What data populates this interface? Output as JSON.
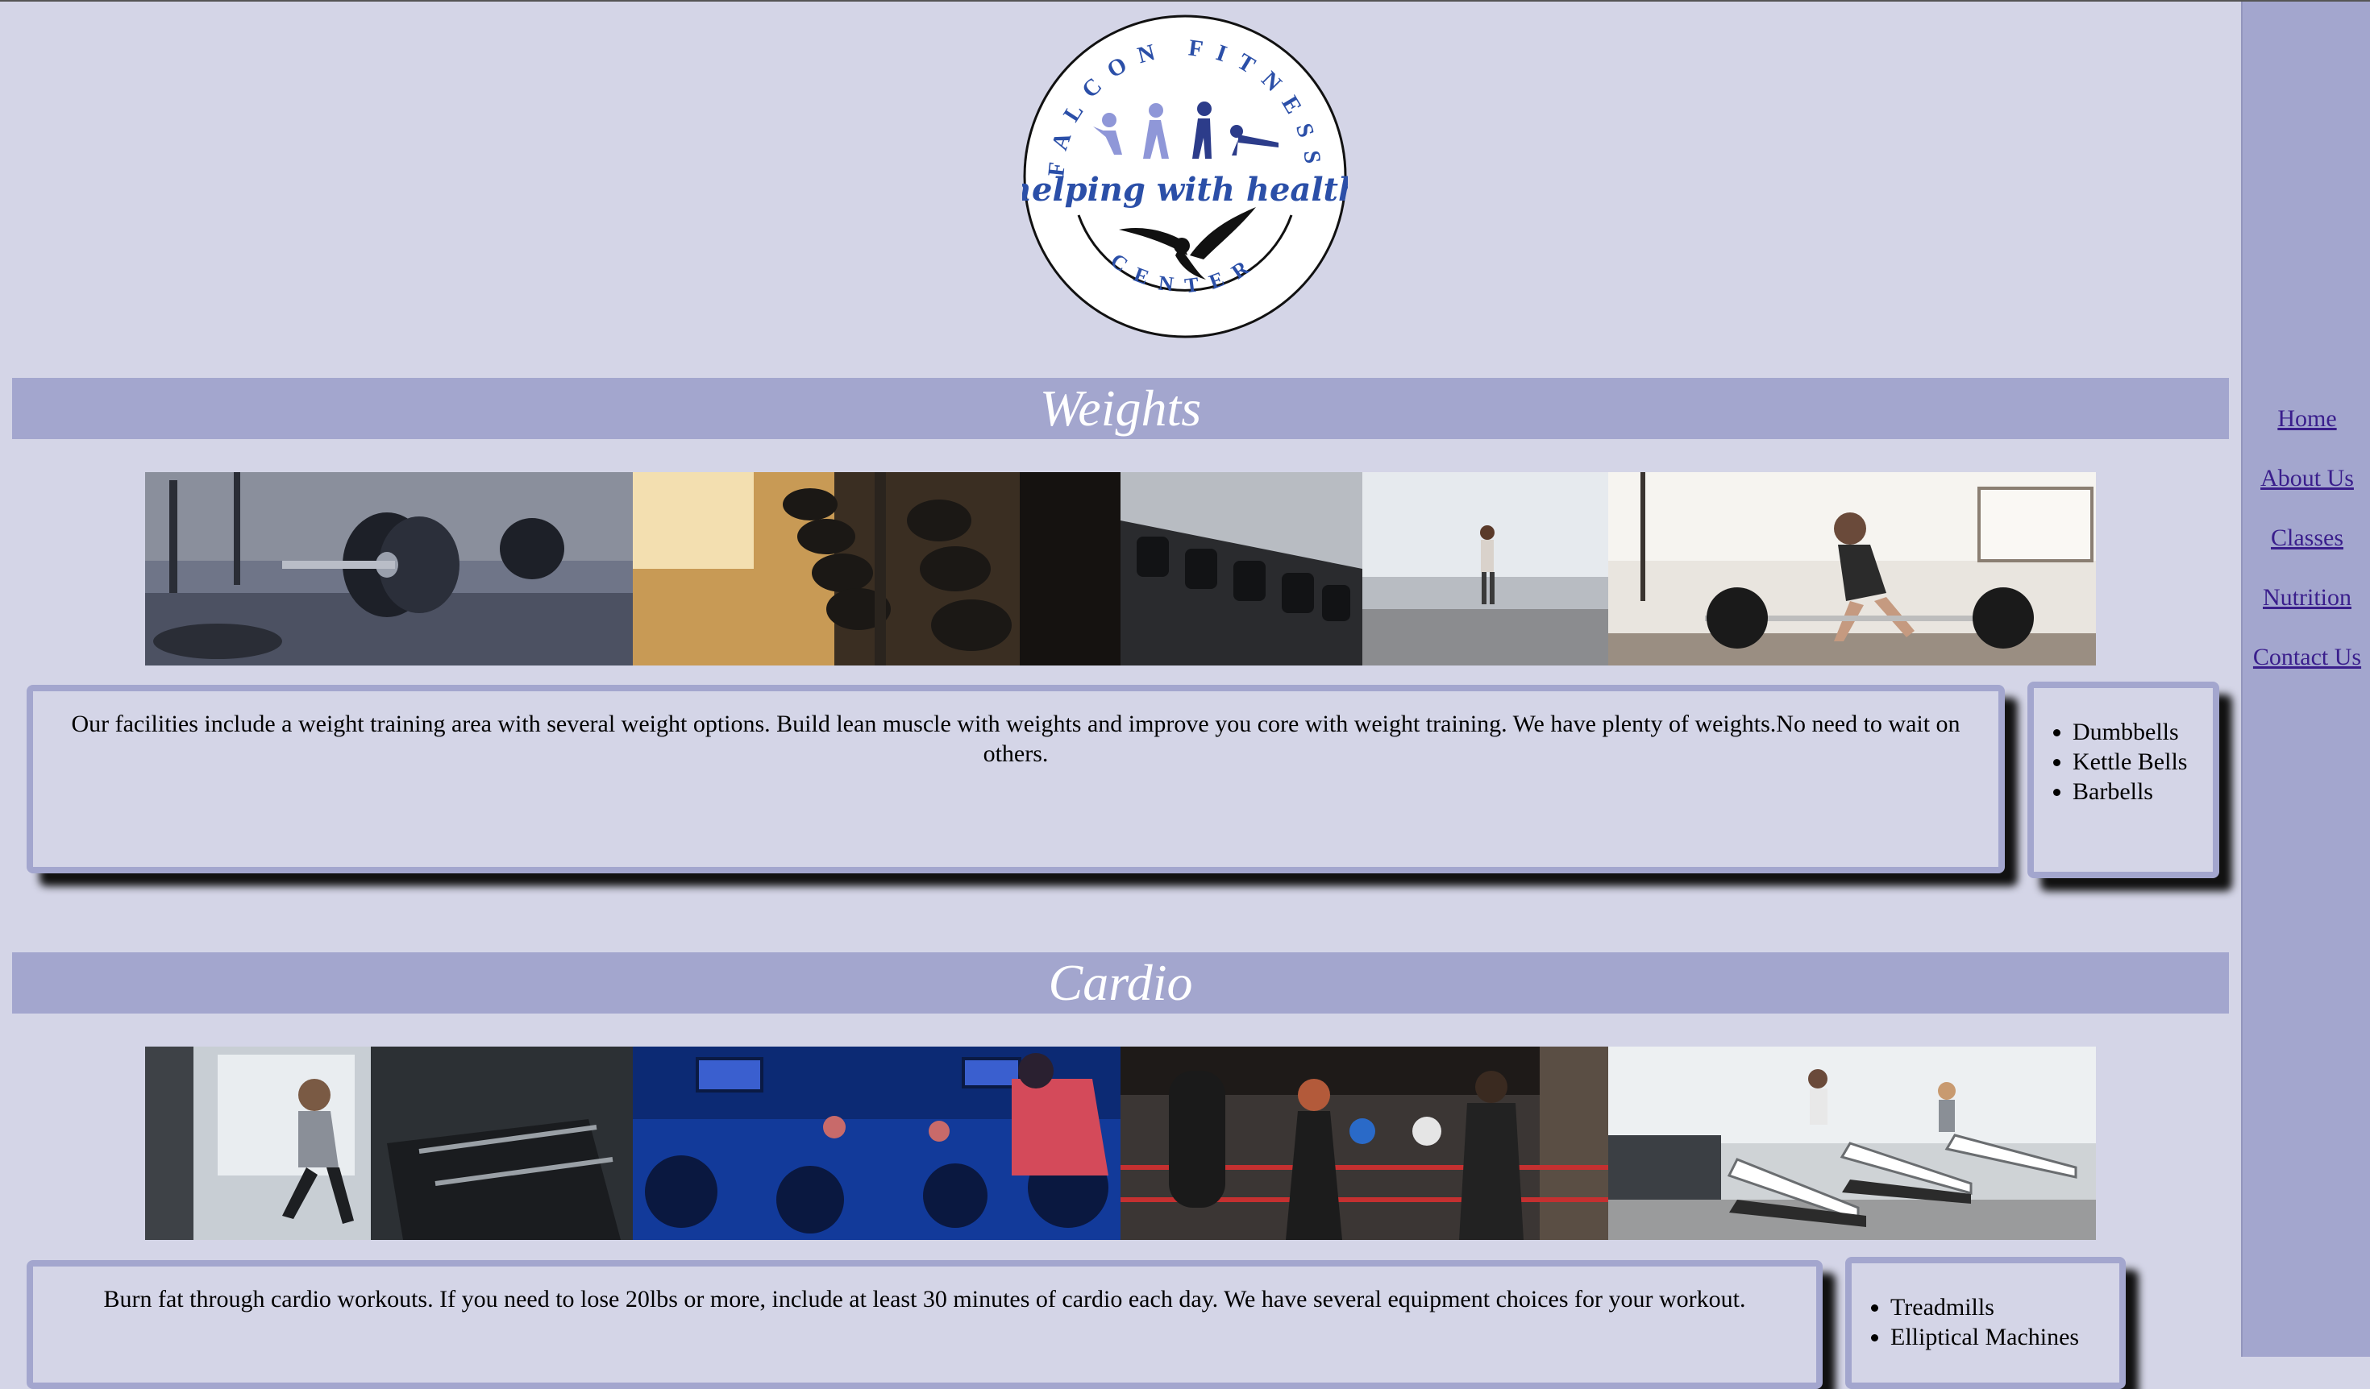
{
  "logo": {
    "brand": "FALCON FITNESS",
    "tagline": "helping with health",
    "subtitle": "CENTER"
  },
  "sections": [
    {
      "title": "Weights",
      "photos": [
        "barbell-plates-photo",
        "dumbbell-rack-photo",
        "dumbbell-row-gym-photo",
        "woman-deadlift-photo"
      ],
      "description": "Our facilities include a weight training area with several weight options. Build lean muscle with weights and improve you core with weight training. We have plenty of weights.No need to wait on others.",
      "items": [
        "Dumbbells",
        "Kettle Bells",
        "Barbells"
      ]
    },
    {
      "title": "Cardio",
      "photos": [
        "woman-treadmill-photo",
        "spin-class-photo",
        "boxing-training-photo",
        "treadmill-row-photo"
      ],
      "description": "Burn fat through cardio workouts. If you need to lose 20lbs or more, include at least 30 minutes of cardio each day. We have several equipment choices for your workout.",
      "items": [
        "Treadmills",
        "Elliptical Machines"
      ]
    }
  ],
  "nav": {
    "items": [
      "Home",
      "About Us",
      "Classes",
      "Nutrition",
      "Contact Us"
    ]
  },
  "colors": {
    "background": "#d4d5e7",
    "accent": "#a3a6ce",
    "link": "#3a1e8c",
    "heading_text": "#ffffff"
  }
}
